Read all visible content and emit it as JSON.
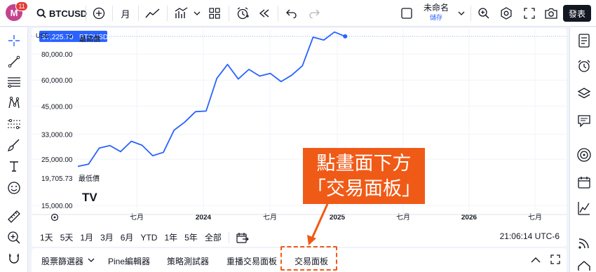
{
  "top_toolbar": {
    "avatar_letter": "M",
    "notification_count": "11",
    "symbol": "BTCUSD",
    "interval_label": "月",
    "layout_name": "未命名",
    "layout_status": "儲存",
    "publish_label": "發表"
  },
  "chart": {
    "currency_label": "USD",
    "legend_high_label": "最高價",
    "legend_low_label": "最低價",
    "current_price": "97,225.70",
    "current_symbol": "BTCUSD",
    "low_price": "19,705.73",
    "brand_logo": "TV"
  },
  "chart_data": {
    "type": "line",
    "x": [
      "2023-01",
      "2023-02",
      "2023-03",
      "2023-04",
      "2023-05",
      "2023-06",
      "2023-07",
      "2023-08",
      "2023-09",
      "2023-10",
      "2023-11",
      "2023-12",
      "2024-01",
      "2024-02",
      "2024-03",
      "2024-04",
      "2024-05",
      "2024-06",
      "2024-07",
      "2024-08",
      "2024-09",
      "2024-10",
      "2024-11",
      "2024-12",
      "2025-01"
    ],
    "y": [
      23100,
      23700,
      28300,
      29100,
      27200,
      30500,
      29200,
      26000,
      27000,
      34500,
      37700,
      42300,
      42600,
      61200,
      71300,
      60700,
      67500,
      62700,
      64600,
      59000,
      63300,
      70300,
      96400,
      93400,
      102000,
      97225.7
    ],
    "yscale": "log",
    "ylim": [
      14000,
      105000
    ],
    "yticks": [
      "80,000.00",
      "60,000.00",
      "45,000.00",
      "33,000.00",
      "25,000.00",
      "15,000.00"
    ],
    "xticks": [
      {
        "label": "七月",
        "bold": false
      },
      {
        "label": "2024",
        "bold": true
      },
      {
        "label": "七月",
        "bold": false
      },
      {
        "label": "2025",
        "bold": true
      },
      {
        "label": "七月",
        "bold": false
      },
      {
        "label": "2026",
        "bold": true
      },
      {
        "label": "七月",
        "bold": false
      }
    ],
    "line_color": "#2962ff"
  },
  "range_buttons": [
    "1天",
    "5天",
    "1月",
    "3月",
    "6月",
    "YTD",
    "1年",
    "5年",
    "全部"
  ],
  "clock": "21:06:14 UTC-6",
  "bottom_tabs": [
    "股票篩選器",
    "Pine編輯器",
    "策略測試器",
    "重播交易面板",
    "交易面板"
  ],
  "annotation": {
    "line1": "點畫面下方",
    "line2": "「交易面板」",
    "color": "#f05a17"
  }
}
